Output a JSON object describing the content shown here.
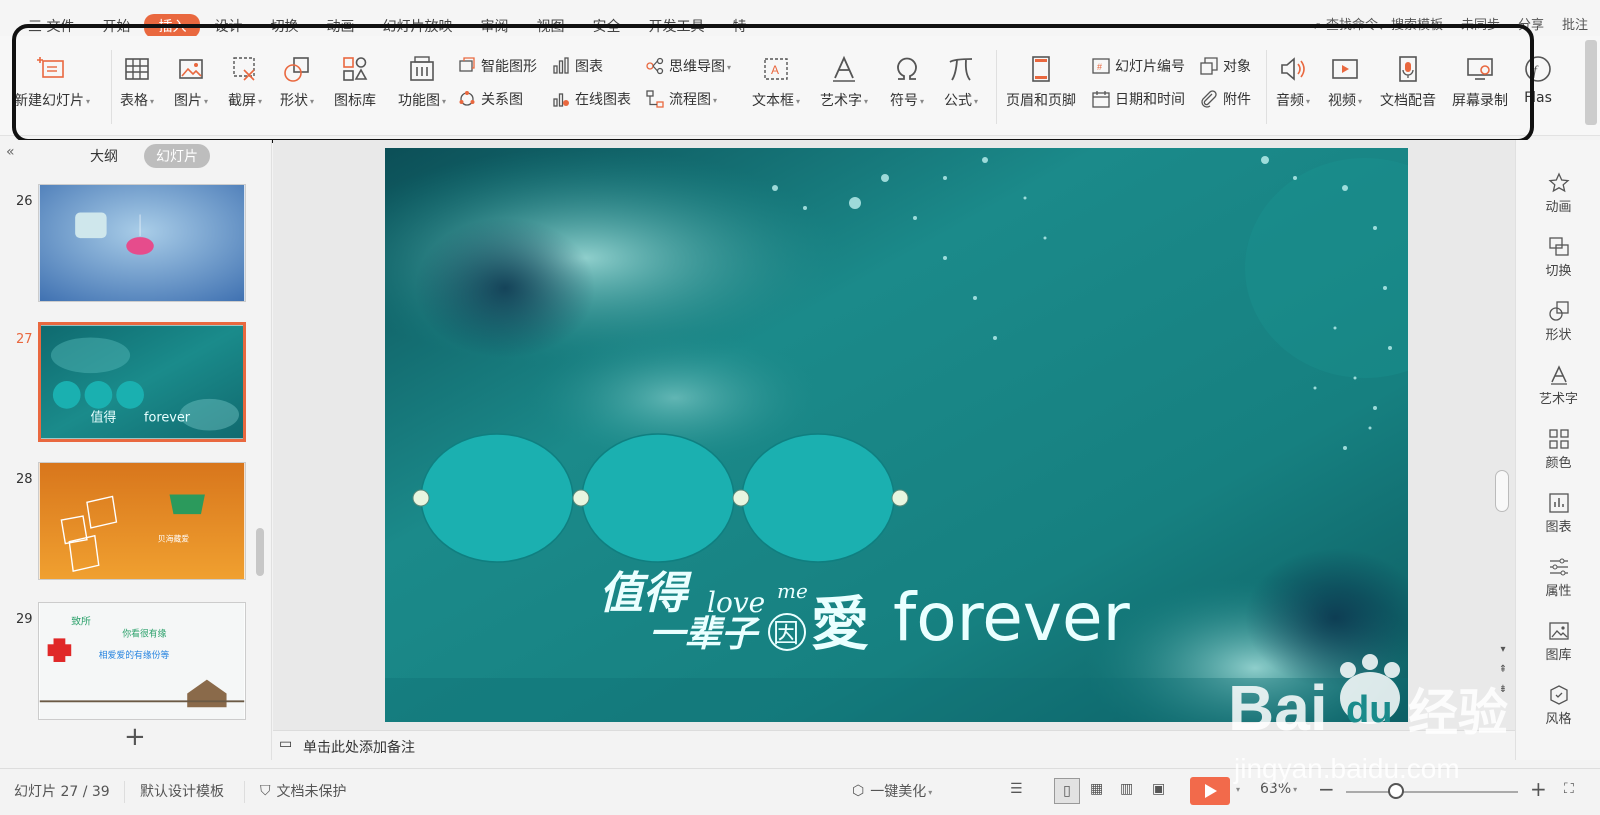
{
  "menubar": {
    "tabs": [
      "三 文件",
      "开始",
      "插入",
      "设计",
      "切换",
      "动画",
      "幻灯片放映",
      "审阅",
      "视图",
      "安全",
      "开发工具",
      "特"
    ],
    "active_tab": "插入",
    "search": "查找命令、搜索模板",
    "sync": "未同步",
    "share": "分享",
    "comment": "批注"
  },
  "ribbon": {
    "new_slide": "新建幻灯片",
    "table": "表格",
    "picture": "图片",
    "screenshot": "截屏",
    "shape": "形状",
    "icon_lib": "图标库",
    "func_chart": "功能图",
    "smart_art": "智能图形",
    "relation": "关系图",
    "chart": "图表",
    "online_chart": "在线图表",
    "mind_map": "思维导图",
    "flowchart": "流程图",
    "textbox": "文本框",
    "wordart": "艺术字",
    "symbol": "符号",
    "formula": "公式",
    "header_footer": "页眉和页脚",
    "slide_number": "幻灯片编号",
    "datetime": "日期和时间",
    "object": "对象",
    "attachment": "附件",
    "audio": "音频",
    "video": "视频",
    "doc_voice": "文档配音",
    "screen_record": "屏幕录制",
    "flash": "Flas"
  },
  "left_panel": {
    "outline_tab": "大纲",
    "slides_tab": "幻灯片",
    "thumbnails": [
      {
        "num": "26"
      },
      {
        "num": "27"
      },
      {
        "num": "28"
      },
      {
        "num": "29"
      }
    ],
    "thumb28_text": "贝海藏爱",
    "thumb29_text1": "致所",
    "thumb29_text2": "你看很有缘",
    "thumb29_text3": "相爱爱的有缘份等"
  },
  "slide": {
    "title_cn_1": "值得",
    "title_cn_2": "一辈子",
    "love": "love",
    "me": "me",
    "yin": "因",
    "ai": "愛",
    "forever": "forever"
  },
  "notes_placeholder": "单击此处添加备注",
  "right_sidebar": [
    "动画",
    "切换",
    "形状",
    "艺术字",
    "颜色",
    "图表",
    "属性",
    "图库",
    "风格"
  ],
  "status": {
    "slide_counter": "幻灯片 27 / 39",
    "template": "默认设计模板",
    "protection": "文档未保护",
    "beautify": "一键美化",
    "zoom": "63%"
  },
  "watermark": {
    "brand": "Bai",
    "du": "du",
    "cn": "经验",
    "url": "jingyan.baidu.com"
  },
  "colors": {
    "accent": "#e9683f",
    "teal": "#1aa6a6"
  }
}
